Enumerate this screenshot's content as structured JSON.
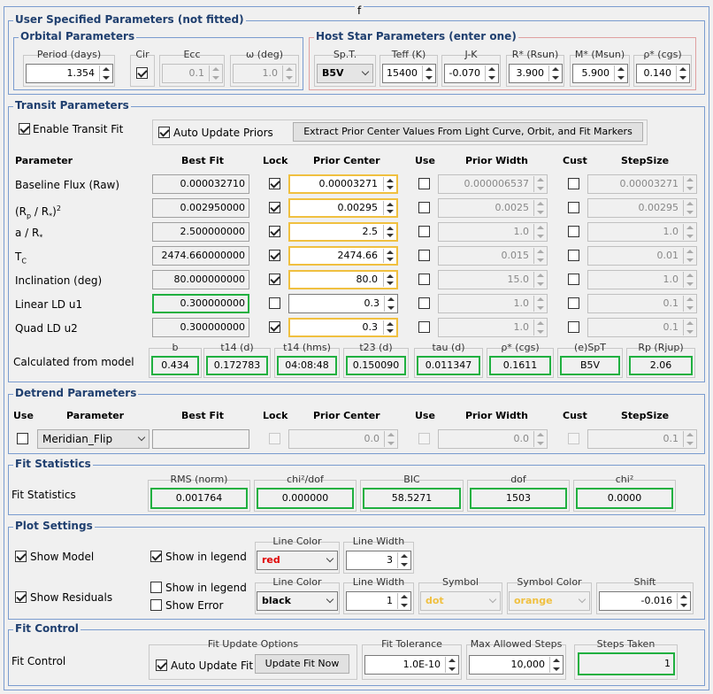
{
  "frame_title": "f",
  "user": {
    "title": "User Specified Parameters (not fitted)",
    "orbital": {
      "title": "Orbital Parameters",
      "period_label": "Period (days)",
      "period": "1.354",
      "cir_label": "Cir",
      "ecc_label": "Ecc",
      "ecc": "0.1",
      "omega_label": "ω (deg)",
      "omega": "1.0"
    },
    "host": {
      "title": "Host Star Parameters (enter one)",
      "spt_label": "Sp.T.",
      "spt": "B5V",
      "teff_label": "Teff (K)",
      "teff": "15400",
      "jk_label": "J-K",
      "jk": "-0.070",
      "rstar_label": "R* (Rsun)",
      "rstar": "3.900",
      "mstar_label": "M* (Msun)",
      "mstar": "5.900",
      "rho_label": "ρ* (cgs)",
      "rho": "0.140"
    }
  },
  "transit": {
    "title": "Transit Parameters",
    "enable_label": "Enable Transit Fit",
    "auto_label": "Auto Update Priors",
    "extract_label": "Extract Prior Center Values From Light Curve, Orbit, and Fit Markers",
    "headers": {
      "param": "Parameter",
      "best": "Best Fit",
      "lock": "Lock",
      "prior": "Prior Center",
      "use": "Use",
      "width": "Prior Width",
      "cust": "Cust",
      "step": "StepSize"
    },
    "rows": [
      {
        "name": "Baseline Flux (Raw)",
        "best": "0.000032710",
        "prior": "0.00003271",
        "width": "0.000006537",
        "step": "0.00003271"
      },
      {
        "name": "(Rp / R*)²",
        "best": "0.002950000",
        "prior": "0.00295",
        "width": "0.0025",
        "step": "0.00295"
      },
      {
        "name": "a / R*",
        "best": "2.500000000",
        "prior": "2.5",
        "width": "1.0",
        "step": "1.0"
      },
      {
        "name": "Tc",
        "best": "2474.660000000",
        "prior": "2474.66",
        "width": "0.015",
        "step": "0.01"
      },
      {
        "name": "Inclination (deg)",
        "best": "80.000000000",
        "prior": "80.0",
        "width": "15.0",
        "step": "1.0"
      },
      {
        "name": "Linear LD u1",
        "best": "0.300000000",
        "prior": "0.3",
        "width": "1.0",
        "step": "0.1"
      },
      {
        "name": "Quad LD u2",
        "best": "0.300000000",
        "prior": "0.3",
        "width": "1.0",
        "step": "0.1"
      }
    ],
    "calc_label": "Calculated from model",
    "calc": [
      {
        "label": "b",
        "value": "0.434"
      },
      {
        "label": "t14 (d)",
        "value": "0.172783"
      },
      {
        "label": "t14 (hms)",
        "value": "04:08:48"
      },
      {
        "label": "t23 (d)",
        "value": "0.150090"
      },
      {
        "label": "tau (d)",
        "value": "0.011347"
      },
      {
        "label": "ρ* (cgs)",
        "value": "0.1611"
      },
      {
        "label": "(e)SpT",
        "value": "B5V"
      },
      {
        "label": "Rp (Rjup)",
        "value": "2.06"
      }
    ]
  },
  "detrend": {
    "title": "Detrend Parameters",
    "headers": {
      "use": "Use",
      "param": "Parameter",
      "best": "Best Fit",
      "lock": "Lock",
      "prior": "Prior Center",
      "use2": "Use",
      "width": "Prior Width",
      "cust": "Cust",
      "step": "StepSize"
    },
    "param": "Meridian_Flip",
    "prior": "0.0",
    "width": "0.0",
    "step": "0.1"
  },
  "fitstats": {
    "title": "Fit Statistics",
    "label": "Fit Statistics",
    "items": [
      {
        "label": "RMS (norm)",
        "value": "0.001764"
      },
      {
        "label": "chi²/dof",
        "value": "0.000000"
      },
      {
        "label": "BIC",
        "value": "58.5271"
      },
      {
        "label": "dof",
        "value": "1503"
      },
      {
        "label": "chi²",
        "value": "0.0000"
      }
    ]
  },
  "plot": {
    "title": "Plot Settings",
    "show_model": "Show Model",
    "show_legend": "Show in legend",
    "line_color_label": "Line Color",
    "line_width_label": "Line Width",
    "model_color": "red",
    "model_width": "3",
    "show_resid": "Show Residuals",
    "resid_legend": "Show in legend",
    "show_error": "Show Error",
    "resid_color": "black",
    "resid_width": "1",
    "symbol_label": "Symbol",
    "symbol": "dot",
    "symbol_color_label": "Symbol Color",
    "symbol_color": "orange",
    "shift_label": "Shift",
    "shift": "-0.016"
  },
  "fitctl": {
    "title": "Fit Control",
    "label": "Fit Control",
    "options_label": "Fit Update Options",
    "auto_label": "Auto Update Fit",
    "update_btn": "Update Fit Now",
    "tol_label": "Fit Tolerance",
    "tol": "1.0E-10",
    "max_label": "Max Allowed Steps",
    "max": "10,000",
    "taken_label": "Steps Taken",
    "taken": "1"
  },
  "colors": {
    "accent": "#1f3f6f",
    "green": "#20b040",
    "yellow": "#f0c040",
    "red": "#e00000",
    "orange": "#f0c040"
  }
}
